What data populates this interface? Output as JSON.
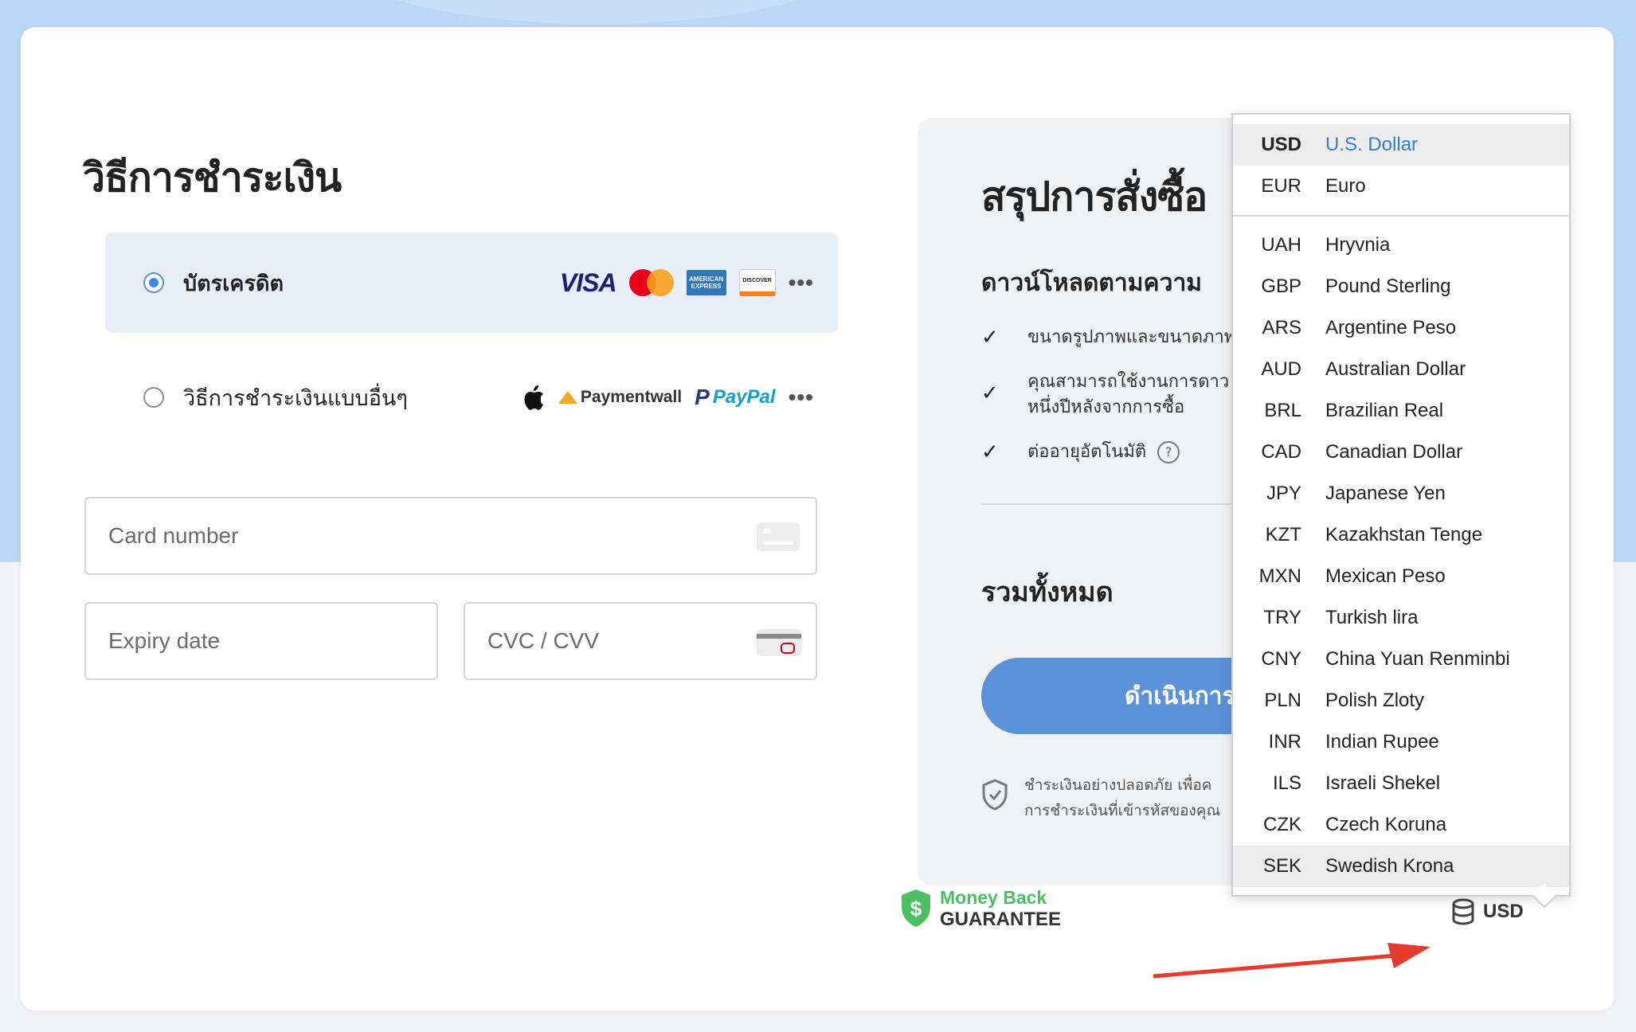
{
  "payment": {
    "title": "วิธีการชำระเงิน",
    "options": [
      {
        "label": "บัตรเครดิต",
        "selected": true,
        "logos": [
          "VISA",
          "mastercard",
          "AMERICAN EXPRESS",
          "DISCOVER"
        ],
        "more": "•••"
      },
      {
        "label": "วิธีการชำระเงินแบบอื่นๆ",
        "selected": false,
        "logos": [
          "apple-logo",
          "Paymentwall",
          "PayPal"
        ],
        "more": "•••"
      }
    ],
    "card_number_placeholder": "Card number",
    "expiry_placeholder": "Expiry date",
    "cvc_placeholder": "CVC / CVV"
  },
  "summary": {
    "title": "สรุปการสั่งซื้อ",
    "subtitle": "ดาวน์โหลดตามความ",
    "features": [
      {
        "line1": "ขนาดรูปภาพและขนาดภาพ",
        "line2": ""
      },
      {
        "line1": "คุณสามารถใช้งานการดาว",
        "line2": "หนึ่งปีหลังจากการซื้อ"
      },
      {
        "line1": "ต่ออายุอัตโนมัติ",
        "line2": ""
      }
    ],
    "help": "?",
    "total_label": "รวมทั้งหมด",
    "proceed": "ดำเนินการ",
    "secure_line1": "ชำระเงินอย่างปลอดภัย เพื่อค",
    "secure_line2": "การชำระเงินที่เข้ารหัสของคุณ"
  },
  "guarantee": {
    "line1": "Money Back",
    "line2": "GUARANTEE"
  },
  "currency": {
    "selected": "USD",
    "pinned": [
      {
        "code": "USD",
        "name": "U.S. Dollar"
      },
      {
        "code": "EUR",
        "name": "Euro"
      }
    ],
    "list": [
      {
        "code": "UAH",
        "name": "Hryvnia"
      },
      {
        "code": "GBP",
        "name": "Pound Sterling"
      },
      {
        "code": "ARS",
        "name": "Argentine Peso"
      },
      {
        "code": "AUD",
        "name": "Australian Dollar"
      },
      {
        "code": "BRL",
        "name": "Brazilian Real"
      },
      {
        "code": "CAD",
        "name": "Canadian Dollar"
      },
      {
        "code": "JPY",
        "name": "Japanese Yen"
      },
      {
        "code": "KZT",
        "name": "Kazakhstan Tenge"
      },
      {
        "code": "MXN",
        "name": "Mexican Peso"
      },
      {
        "code": "TRY",
        "name": "Turkish lira"
      },
      {
        "code": "CNY",
        "name": "China Yuan Renminbi"
      },
      {
        "code": "PLN",
        "name": "Polish Zloty"
      },
      {
        "code": "INR",
        "name": "Indian Rupee"
      },
      {
        "code": "ILS",
        "name": "Israeli Shekel"
      },
      {
        "code": "CZK",
        "name": "Czech Koruna"
      },
      {
        "code": "SEK",
        "name": "Swedish Krona"
      }
    ]
  },
  "colors": {
    "accent": "#5b92da",
    "link": "#2f7fd6",
    "annotation": "#e53b2c",
    "guarantee": "#4cbf63"
  }
}
